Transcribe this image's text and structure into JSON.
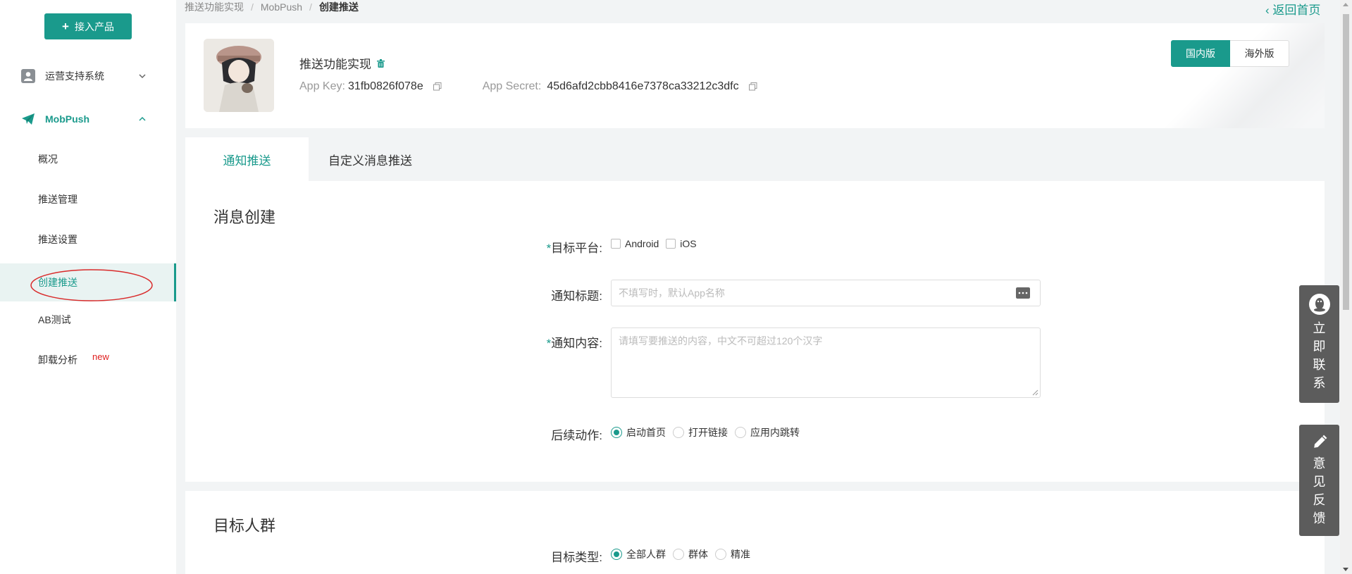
{
  "sidebar": {
    "add_button": "接入产品",
    "groups": [
      {
        "label": "运营支持系统",
        "icon": "user-icon",
        "expanded": false
      },
      {
        "label": "MobPush",
        "icon": "paper-plane-icon",
        "expanded": true
      }
    ],
    "items": [
      {
        "label": "概况"
      },
      {
        "label": "推送管理"
      },
      {
        "label": "推送设置"
      },
      {
        "label": "创建推送",
        "active": true
      },
      {
        "label": "AB测试"
      },
      {
        "label": "卸载分析",
        "badge": "new"
      }
    ]
  },
  "breadcrumb": [
    "推送功能实现",
    "MobPush",
    "创建推送"
  ],
  "back_home": "返回首页",
  "app": {
    "name": "推送功能实现",
    "key_label": "App Key:",
    "key_value": "31fb0826f078e",
    "secret_label": "App Secret:",
    "secret_value": "45d6afd2cbb8416e7378ca33212c3dfc"
  },
  "region": {
    "domestic": "国内版",
    "overseas": "海外版",
    "selected": "国内版"
  },
  "tabs": [
    {
      "label": "通知推送",
      "active": true
    },
    {
      "label": "自定义消息推送",
      "active": false
    }
  ],
  "message_section": {
    "title": "消息创建",
    "platform": {
      "label": "目标平台:",
      "options": [
        "Android",
        "iOS"
      ]
    },
    "notify_title": {
      "label": "通知标题:",
      "placeholder": "不填写时，默认App名称"
    },
    "notify_content": {
      "label": "通知内容:",
      "placeholder": "请填写要推送的内容，中文不可超过120个汉字"
    },
    "follow_action": {
      "label": "后续动作:",
      "options": [
        "启动首页",
        "打开链接",
        "应用内跳转"
      ],
      "selected": "启动首页"
    }
  },
  "target_section": {
    "title": "目标人群",
    "target_type": {
      "label": "目标类型:",
      "options": [
        "全部人群",
        "群体",
        "精准"
      ],
      "selected": "全部人群"
    }
  },
  "float_buttons": [
    {
      "text": "立即联系",
      "icon": "qq-icon"
    },
    {
      "text": "意见反馈",
      "icon": "pencil-icon"
    }
  ],
  "colors": {
    "accent": "#1a9a8c",
    "badge": "#e02020",
    "float": "#5c5c5c"
  }
}
